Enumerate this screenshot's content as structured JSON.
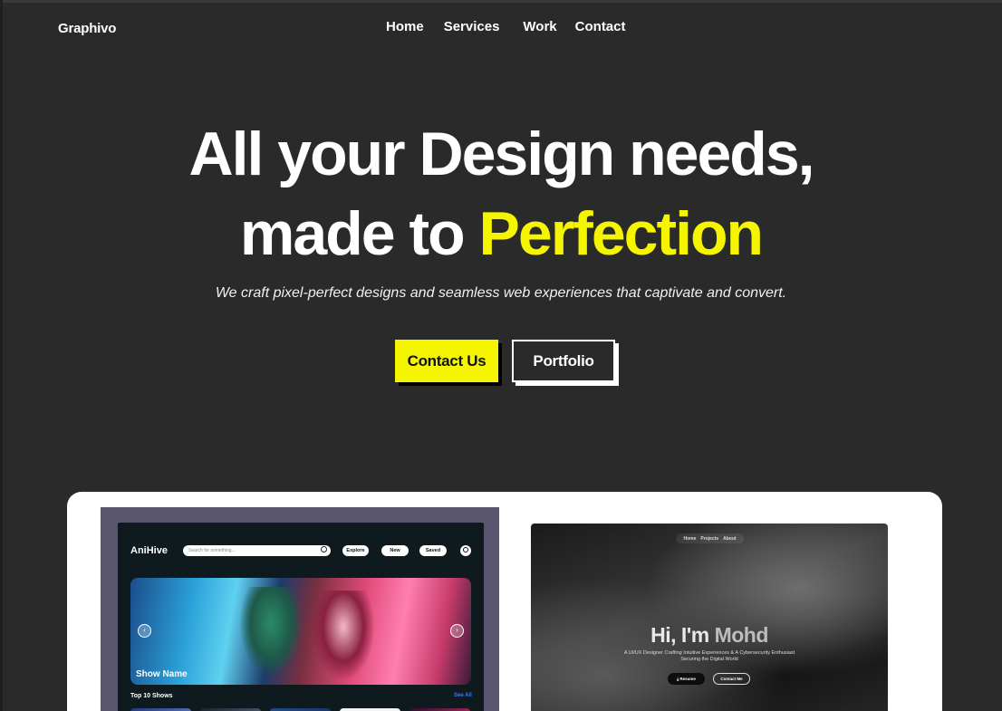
{
  "brand": "Graphivo",
  "nav": {
    "home": "Home",
    "services": "Services",
    "work": "Work",
    "contact": "Contact"
  },
  "hero": {
    "line1": "All your Design needs,",
    "line2_prefix": "made to",
    "line2_accent": "Perfection",
    "subtitle": "We craft pixel-perfect designs and seamless web experiences that captivate and convert.",
    "cta_primary": "Contact Us",
    "cta_secondary": "Portfolio"
  },
  "colors": {
    "accent": "#f5f500",
    "background": "#2a2a2a"
  },
  "showcase": {
    "anihive": {
      "logo": "AniHive",
      "search_placeholder": "Search for something...",
      "explore": "Explore",
      "new": "New",
      "saved": "Saved",
      "banner_title": "Show Name",
      "section_title": "Top 10 Shows",
      "see_all": "See All"
    },
    "portfolio": {
      "nav": [
        "Home",
        "Projects",
        "About"
      ],
      "greeting_prefix": "Hi, I'm",
      "greeting_name": "Mohd",
      "desc_line1": "A UI/UX Designer Crafting Intuitive Experiences & A Cybersecurity Enthusiast",
      "desc_line2": "Securing the Digital World",
      "resume": "Resume",
      "contact_me": "Contact Me"
    }
  }
}
